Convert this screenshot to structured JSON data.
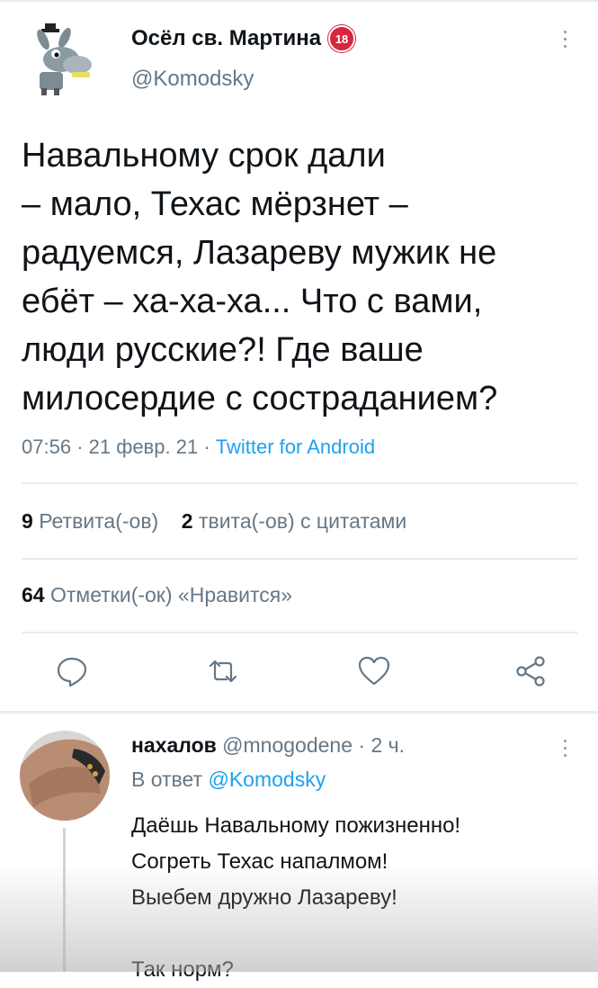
{
  "tweet": {
    "author_name": "Осёл св. Мартина",
    "author_badge": "18",
    "author_handle": "@Komodsky",
    "text_lines": [
      "Навальному срок дали",
      "– мало, Техас мёрзнет –",
      "радуемся, Лазареву мужик не",
      "ебёт – ха-ха-ха... Что с вами,",
      "люди русские?! Где ваше",
      "милосердие с состраданием?"
    ],
    "time": "07:56",
    "date": "21 февр. 21",
    "separator": "·",
    "source": "Twitter for Android",
    "retweets_count": "9",
    "retweets_label": "Ретвита(-ов)",
    "quotes_count": "2",
    "quotes_label": "твита(-ов) с цитатами",
    "likes_count": "64",
    "likes_label": "Отметки(-ок) «Нравится»"
  },
  "actions": {
    "reply_icon": "reply-icon",
    "retweet_icon": "retweet-icon",
    "like_icon": "heart-icon",
    "share_icon": "share-icon"
  },
  "reply": {
    "author_name": "нахалов",
    "author_handle": "@mnogodene",
    "time_ago": "2 ч.",
    "separator": "·",
    "reply_to_prefix": "В ответ",
    "reply_to_handle": "@Komodsky",
    "text_lines": [
      "Даёшь Навальному пожизненно!",
      "Согреть Техас напалмом!",
      "Выебем дружно Лазареву!",
      "",
      "Так норм?"
    ]
  },
  "colors": {
    "link": "#1da1f2",
    "secondary_text": "#657786",
    "primary_text": "#0f1419",
    "badge": "#d7263d",
    "divider": "#e6ecf0"
  }
}
